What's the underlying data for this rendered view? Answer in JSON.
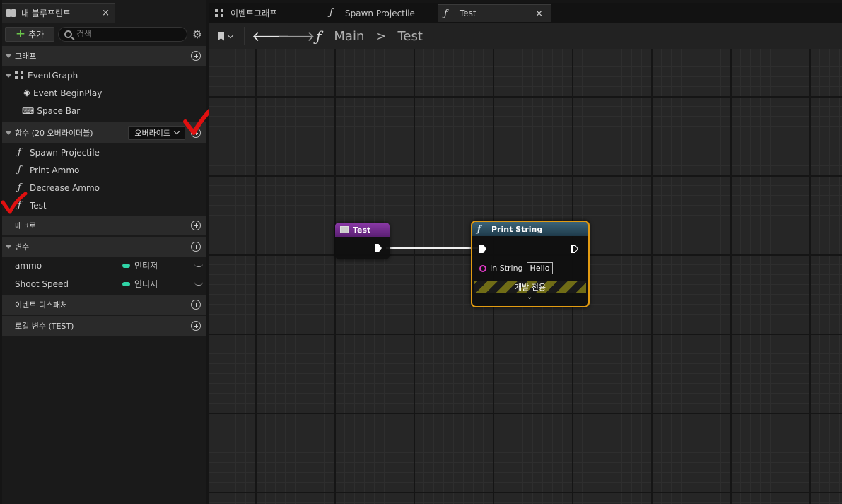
{
  "left_panel": {
    "tab_title": "내 블루프린트",
    "tab_close": "×",
    "add_label": "추가",
    "search_placeholder": "검색",
    "sections": {
      "graph": "그래프",
      "functions": "함수 (20 오버라이더블)",
      "override": "오버라이드",
      "macros": "매크로",
      "variables": "변수",
      "dispatchers": "이벤트 디스패처",
      "local_vars": "로컬 변수 (TEST)"
    },
    "graph_items": {
      "event_graph": "EventGraph",
      "begin_play": "Event BeginPlay",
      "space_bar": "Space Bar"
    },
    "functions": [
      "Spawn Projectile",
      "Print Ammo",
      "Decrease Ammo",
      "Test"
    ],
    "variables": [
      {
        "name": "ammo",
        "type": "인티저"
      },
      {
        "name": "Shoot Speed",
        "type": "인티저"
      }
    ]
  },
  "tabs": [
    {
      "label": "이벤트그래프"
    },
    {
      "label": "Spawn Projectile"
    },
    {
      "label": "Test",
      "close": "×"
    }
  ],
  "breadcrumb": {
    "root": "Main",
    "separator": ">",
    "current": "Test"
  },
  "nodes": {
    "entry": {
      "title": "Test",
      "color": "#6b2a8c"
    },
    "print": {
      "title": "Print String",
      "pin_label": "In String",
      "pin_value": "Hello",
      "dev_only": "개발 전용",
      "color": "#2b4a5e",
      "border": "#e29b12"
    }
  },
  "colors": {
    "accent_green": "#6ac44a",
    "integer_pin": "#2fd4a6",
    "string_pin": "#e23ac8",
    "annotation_red": "#e01010"
  }
}
